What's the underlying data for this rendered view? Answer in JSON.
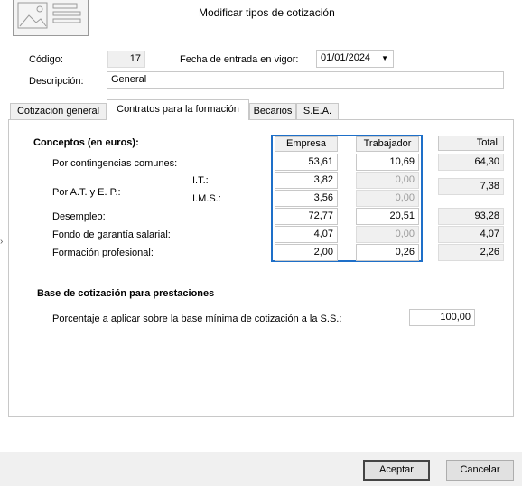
{
  "dialog": {
    "title": "Modificar tipos de cotización"
  },
  "header": {
    "codigo_label": "Código:",
    "codigo_value": "17",
    "fecha_label": "Fecha de entrada en vigor:",
    "fecha_value": "01/01/2024",
    "descripcion_label": "Descripción:",
    "descripcion_value": "General"
  },
  "tabs": [
    {
      "label": "Cotización general",
      "active": false
    },
    {
      "label": "Contratos para la formación",
      "active": true
    },
    {
      "label": "Becarios",
      "active": false
    },
    {
      "label": "S.E.A.",
      "active": false
    }
  ],
  "conceptos": {
    "title": "Conceptos (en euros):",
    "col_empresa": "Empresa",
    "col_trabajador": "Trabajador",
    "col_total": "Total",
    "rows": {
      "contingencias": {
        "label": "Por contingencias comunes:",
        "empresa": "53,61",
        "trabajador": "10,69",
        "total": "64,30"
      },
      "at_ep": {
        "label": "Por A.T. y E. P.:",
        "total": "7,38"
      },
      "it": {
        "label": "I.T.:",
        "empresa": "3,82",
        "trabajador": "0,00"
      },
      "ims": {
        "label": "I.M.S.:",
        "empresa": "3,56",
        "trabajador": "0,00"
      },
      "desempleo": {
        "label": "Desempleo:",
        "empresa": "72,77",
        "trabajador": "20,51",
        "total": "93,28"
      },
      "fogasa": {
        "label": "Fondo de garantía salarial:",
        "empresa": "4,07",
        "trabajador": "0,00",
        "total": "4,07"
      },
      "formacion": {
        "label": "Formación profesional:",
        "empresa": "2,00",
        "trabajador": "0,26",
        "total": "2,26"
      }
    }
  },
  "base": {
    "title": "Base de cotización para prestaciones",
    "porcentaje_label": "Porcentaje a aplicar sobre la base mínima de cotización a la S.S.:",
    "porcentaje_value": "100,00"
  },
  "buttons": {
    "accept": "Aceptar",
    "cancel": "Cancelar"
  },
  "colors": {
    "accent_border": "#1e6fc8",
    "footer_bg": "#f0f0f0"
  }
}
